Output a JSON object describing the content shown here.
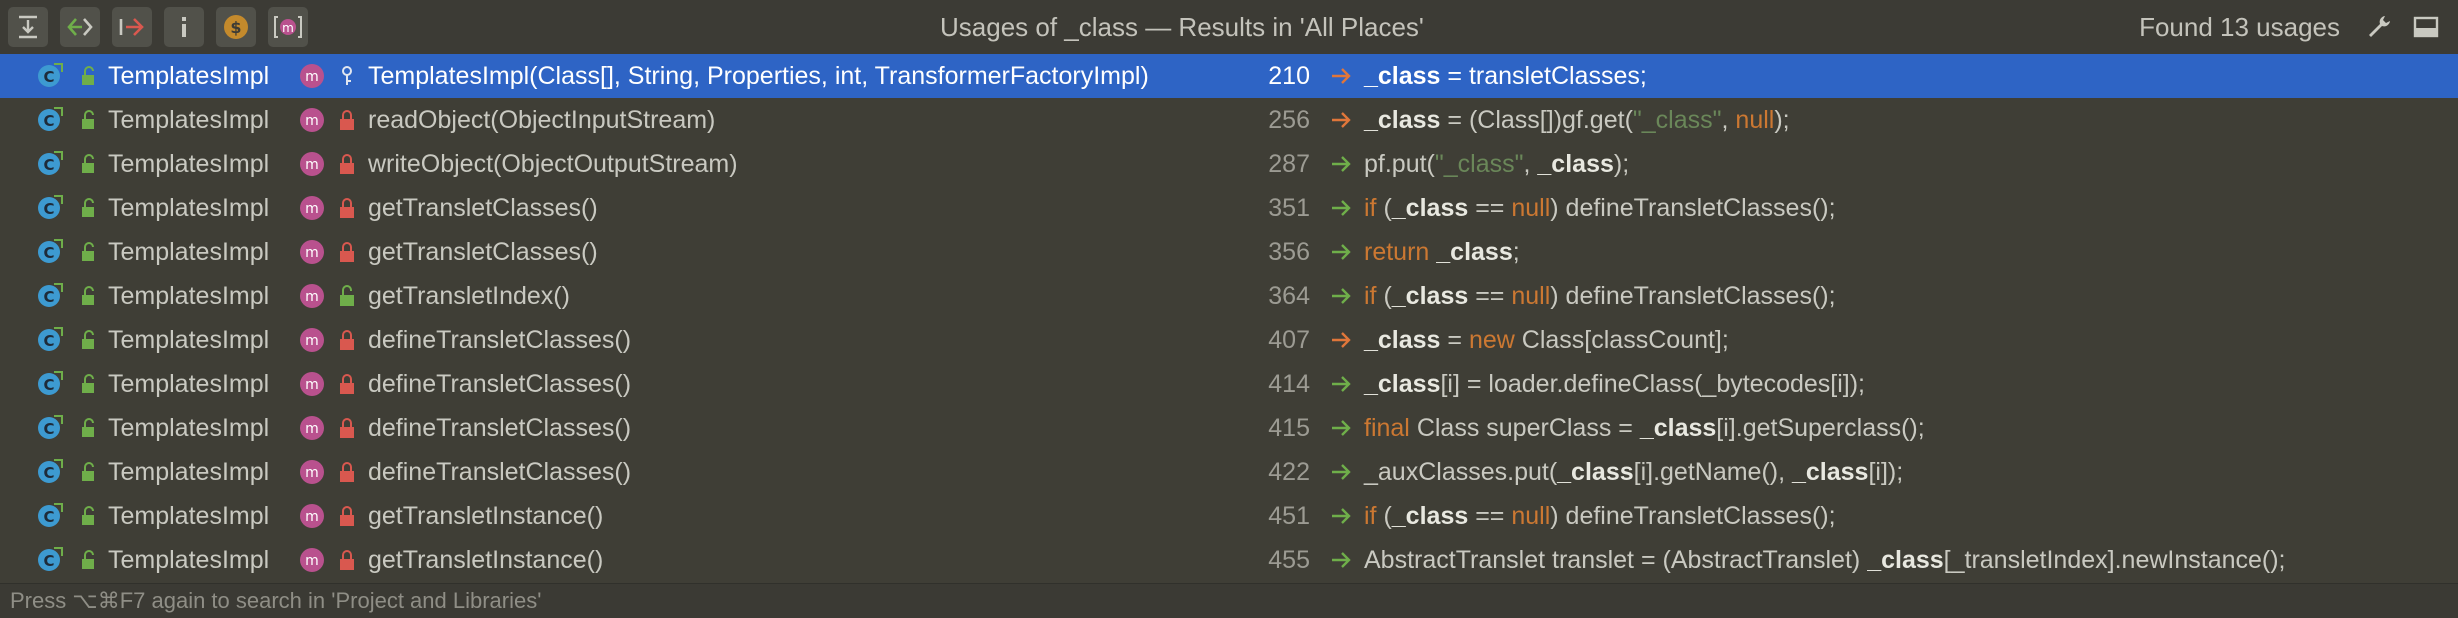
{
  "toolbar": {
    "buttons": [
      {
        "name": "expand-all-icon"
      },
      {
        "name": "previous-occurrence-icon"
      },
      {
        "name": "next-occurrence-icon"
      },
      {
        "name": "info-icon"
      },
      {
        "name": "coin-icon"
      },
      {
        "name": "group-by-method-icon"
      }
    ]
  },
  "header": {
    "title": "Usages of _class — Results in 'All Places'",
    "found": "Found 13 usages"
  },
  "rows": [
    {
      "cls": "TemplatesImpl",
      "method": "TemplatesImpl(Class[], String, Properties, int, TransformerFactoryImpl)",
      "line": "210",
      "write": true,
      "selected": true,
      "lock": "key",
      "code": [
        {
          "t": "_class",
          "c": "hl"
        },
        {
          "t": "     = transletClasses;"
        }
      ]
    },
    {
      "cls": "TemplatesImpl",
      "method": "readObject(ObjectInputStream)",
      "line": "256",
      "write": true,
      "lock": "private",
      "code": [
        {
          "t": "_class",
          "c": "hl"
        },
        {
          "t": " = (Class[])gf.get("
        },
        {
          "t": "\"_class\"",
          "c": "str"
        },
        {
          "t": ", "
        },
        {
          "t": "null",
          "c": "kw"
        },
        {
          "t": ");"
        }
      ]
    },
    {
      "cls": "TemplatesImpl",
      "method": "writeObject(ObjectOutputStream)",
      "line": "287",
      "write": false,
      "lock": "private",
      "code": [
        {
          "t": "pf.put("
        },
        {
          "t": "\"_class\"",
          "c": "str"
        },
        {
          "t": ", "
        },
        {
          "t": "_class",
          "c": "hl"
        },
        {
          "t": ");"
        }
      ]
    },
    {
      "cls": "TemplatesImpl",
      "method": "getTransletClasses()",
      "line": "351",
      "write": false,
      "lock": "private",
      "code": [
        {
          "t": "if",
          "c": "kw"
        },
        {
          "t": " ("
        },
        {
          "t": "_class",
          "c": "hl"
        },
        {
          "t": " == "
        },
        {
          "t": "null",
          "c": "kw"
        },
        {
          "t": ") defineTransletClasses();"
        }
      ]
    },
    {
      "cls": "TemplatesImpl",
      "method": "getTransletClasses()",
      "line": "356",
      "write": false,
      "lock": "private",
      "code": [
        {
          "t": "return",
          "c": "kw"
        },
        {
          "t": " "
        },
        {
          "t": "_class",
          "c": "hl"
        },
        {
          "t": ";"
        }
      ]
    },
    {
      "cls": "TemplatesImpl",
      "method": "getTransletIndex()",
      "line": "364",
      "write": false,
      "lock": "public",
      "code": [
        {
          "t": "if",
          "c": "kw"
        },
        {
          "t": " ("
        },
        {
          "t": "_class",
          "c": "hl"
        },
        {
          "t": " == "
        },
        {
          "t": "null",
          "c": "kw"
        },
        {
          "t": ") defineTransletClasses();"
        }
      ]
    },
    {
      "cls": "TemplatesImpl",
      "method": "defineTransletClasses()",
      "line": "407",
      "write": true,
      "lock": "private",
      "code": [
        {
          "t": "_class",
          "c": "hl"
        },
        {
          "t": " = "
        },
        {
          "t": "new",
          "c": "kw"
        },
        {
          "t": " Class[classCount];"
        }
      ]
    },
    {
      "cls": "TemplatesImpl",
      "method": "defineTransletClasses()",
      "line": "414",
      "write": false,
      "lock": "private",
      "code": [
        {
          "t": "_class",
          "c": "hl"
        },
        {
          "t": "[i] = loader.defineClass(_bytecodes[i]);"
        }
      ]
    },
    {
      "cls": "TemplatesImpl",
      "method": "defineTransletClasses()",
      "line": "415",
      "write": false,
      "lock": "private",
      "code": [
        {
          "t": "final",
          "c": "kw"
        },
        {
          "t": " Class superClass = "
        },
        {
          "t": "_class",
          "c": "hl"
        },
        {
          "t": "[i].getSuperclass();"
        }
      ]
    },
    {
      "cls": "TemplatesImpl",
      "method": "defineTransletClasses()",
      "line": "422",
      "write": false,
      "lock": "private",
      "code": [
        {
          "t": "_auxClasses.put("
        },
        {
          "t": "_class",
          "c": "hl"
        },
        {
          "t": "[i].getName(), "
        },
        {
          "t": "_class",
          "c": "hl"
        },
        {
          "t": "[i]);"
        }
      ]
    },
    {
      "cls": "TemplatesImpl",
      "method": "getTransletInstance()",
      "line": "451",
      "write": false,
      "lock": "private",
      "code": [
        {
          "t": "if",
          "c": "kw"
        },
        {
          "t": " ("
        },
        {
          "t": "_class",
          "c": "hl"
        },
        {
          "t": " == "
        },
        {
          "t": "null",
          "c": "kw"
        },
        {
          "t": ") defineTransletClasses();"
        }
      ]
    },
    {
      "cls": "TemplatesImpl",
      "method": "getTransletInstance()",
      "line": "455",
      "write": false,
      "lock": "private",
      "code": [
        {
          "t": "AbstractTranslet translet = (AbstractTranslet) "
        },
        {
          "t": "_class",
          "c": "hl"
        },
        {
          "t": "[_transletIndex].newInstance();"
        }
      ]
    }
  ],
  "footer": {
    "hint": "Press ⌥⌘F7 again to search in 'Project and Libraries'"
  },
  "colors": {
    "selection": "#2e64c5",
    "keyword": "#cc7832",
    "string": "#6a8759",
    "write_arrow": "#e0763a",
    "read_arrow": "#6fae4a",
    "method_badge": "#b9518e",
    "class_badge": "#3d9ad1"
  }
}
